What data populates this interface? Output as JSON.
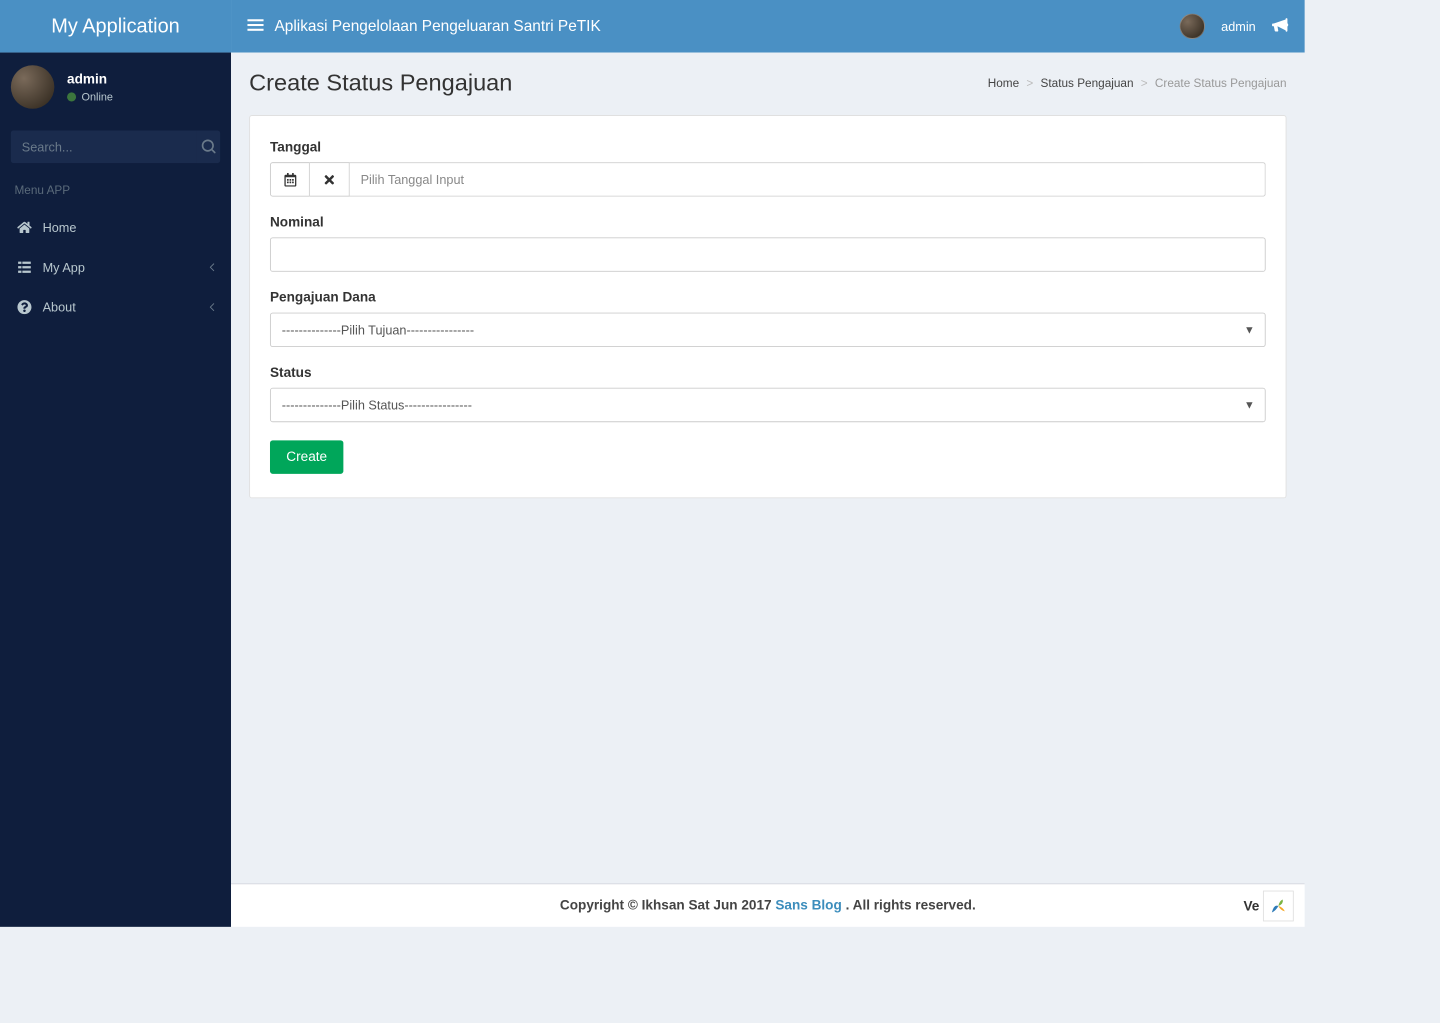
{
  "header": {
    "logo": "My Application",
    "title": "Aplikasi Pengelolaan Pengeluaran Santri PeTIK",
    "user": "admin"
  },
  "sidebar": {
    "user": {
      "name": "admin",
      "status": "Online"
    },
    "search_placeholder": "Search...",
    "menu_header": "Menu APP",
    "items": [
      {
        "label": "Home",
        "icon": "home-icon",
        "chevron": false
      },
      {
        "label": "My App",
        "icon": "list-icon",
        "chevron": true
      },
      {
        "label": "About",
        "icon": "question-icon",
        "chevron": true
      }
    ]
  },
  "page": {
    "title": "Create Status Pengajuan",
    "breadcrumb": {
      "home": "Home",
      "parent": "Status Pengajuan",
      "current": "Create Status Pengajuan"
    }
  },
  "form": {
    "tanggal": {
      "label": "Tanggal",
      "placeholder": "Pilih Tanggal Input"
    },
    "nominal": {
      "label": "Nominal",
      "value": ""
    },
    "pengajuan": {
      "label": "Pengajuan Dana",
      "selected": "--------------Pilih Tujuan----------------"
    },
    "status": {
      "label": "Status",
      "selected": "--------------Pilih Status----------------"
    },
    "submit": "Create"
  },
  "footer": {
    "copyright_prefix": "Copyright © Ikhsan Sat Jun 2017 ",
    "link": "Sans Blog",
    "rights": " . All rights reserved.",
    "ve": "Ve"
  }
}
